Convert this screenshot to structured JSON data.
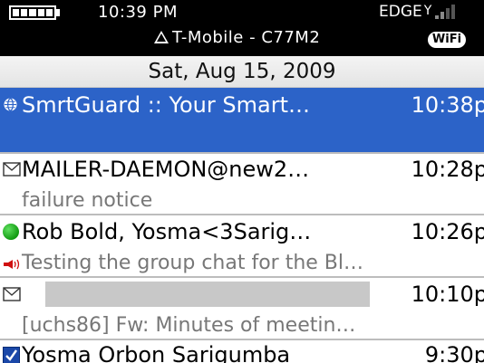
{
  "status_bar": {
    "time": "10:39 PM",
    "carrier": "T-Mobile - C77M2",
    "network": "EDGE",
    "wifi_label": "WiFi"
  },
  "date_header": "Sat, Aug 15, 2009",
  "messages": [
    {
      "icon": "globe-icon",
      "from": "SmrtGuard :: Your Smart…",
      "time": "10:38p",
      "subject": "",
      "selected": true
    },
    {
      "icon": "envelope-icon",
      "from": "MAILER-DAEMON@new2…",
      "time": "10:28p",
      "subject": "failure notice"
    },
    {
      "icon": "green-dot-icon",
      "from": "Rob Bold, Yosma<3Sarig…",
      "time": "10:26p",
      "subject": "Testing the group chat for the Bl…",
      "subject_icon": "megaphone-icon"
    },
    {
      "icon": "envelope-icon",
      "from": "",
      "time": "10:10p",
      "subject": "[uchs86] Fw: Minutes of meetin…",
      "from_redacted": true
    },
    {
      "icon": "checkbox-icon",
      "from": "Yosma Orbon Sarigumba",
      "time": "9:30p",
      "subject": ""
    }
  ],
  "colors": {
    "selection": "#2c63c8",
    "subject_text": "#777777",
    "status_bar_bg": "#000000"
  }
}
